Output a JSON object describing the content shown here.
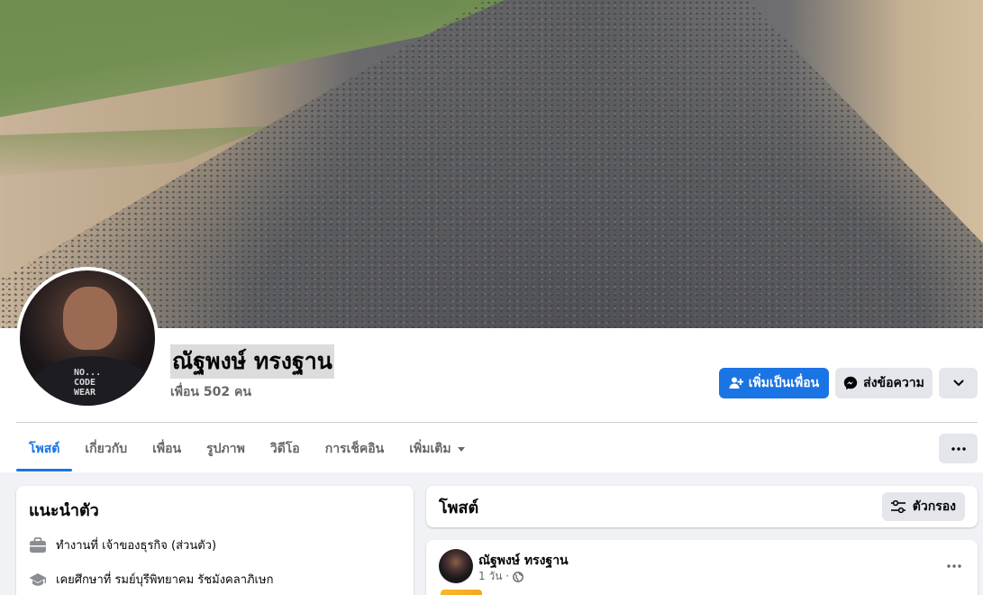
{
  "profile": {
    "name": "ณัฐพงษ์ ทรงฐาน",
    "friends": "เพื่อน 502 คน",
    "shirt_print": "NO...\nCODE\nWEAR"
  },
  "actions": {
    "add_friend": "เพิ่มเป็นเพื่อน",
    "message": "ส่งข้อความ"
  },
  "tabs": [
    {
      "label": "โพสต์",
      "active": true
    },
    {
      "label": "เกี่ยวกับ"
    },
    {
      "label": "เพื่อน"
    },
    {
      "label": "รูปภาพ"
    },
    {
      "label": "วิดีโอ"
    },
    {
      "label": "การเช็คอิน"
    },
    {
      "label": "เพิ่มเติม"
    }
  ],
  "intro": {
    "title": "แนะนำตัว",
    "work": "ทำงานที่ เจ้าของธุรกิจ (ส่วนตัว)",
    "education": "เคยศึกษาที่ รมย์บุรีพิทยาคม รัชมังคลาภิเษก"
  },
  "posts": {
    "title": "โพสต์",
    "filter": "ตัวกรอง"
  },
  "post": {
    "author": "ณัฐพงษ์ ทรงฐาน",
    "time": "1 วัน ·"
  },
  "colors": {
    "accent": "#1b74e4",
    "secondary_text": "#65676b",
    "button_gray": "#e4e6eb"
  },
  "icons": {
    "add_friend": "add-user-icon",
    "message": "messenger-icon",
    "dropdown": "chevron-down-icon",
    "more": "more-dots-icon",
    "work": "briefcase-icon",
    "education": "graduation-cap-icon",
    "filter": "filter-sliders-icon",
    "audience": "globe-icon"
  }
}
